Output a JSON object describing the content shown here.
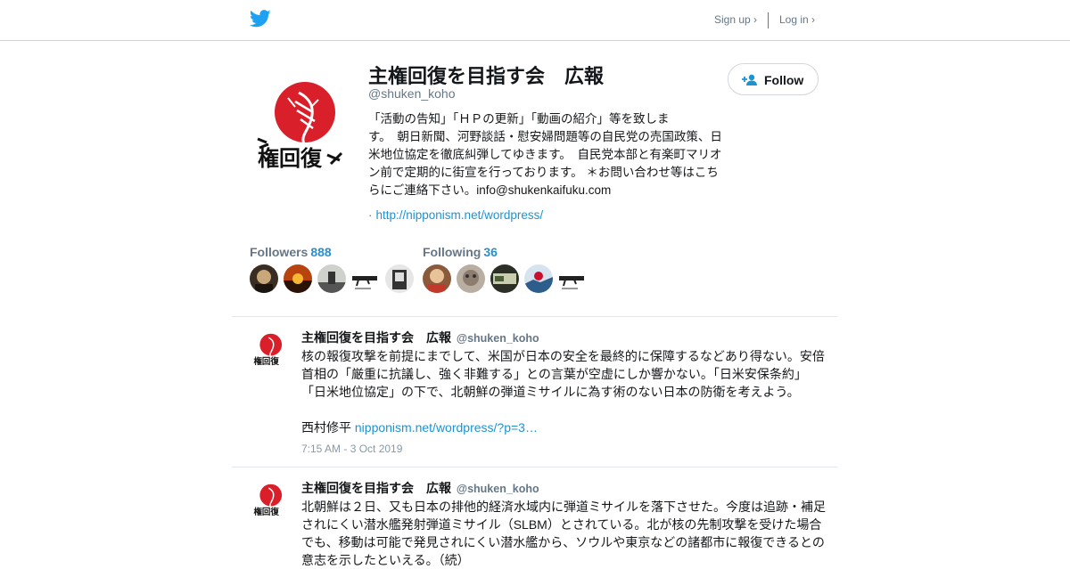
{
  "header": {
    "logo_icon": "twitter-bird-icon",
    "signup_label": "Sign up ›",
    "login_label": "Log in ›"
  },
  "profile": {
    "name": "主権回復を目指す会　広報",
    "handle": "@shuken_koho",
    "avatar_icon": "red-circle-logo-avatar",
    "bio_lines": [
      "「活動の告知」「ＨＰの更新」「動画の紹介」等を致しま",
      "す。　朝日新聞、河野談話・慰安婦問題等の自民党の売国政策、日",
      "米地位協定を徹底糾弾してゆきます。　自民党本部と有楽町マリオ",
      "ン前で定期的に街宣を行っております。 ＊お問い合わせ等はこち",
      "らにご連絡下さい。info@shukenkaifuku.com"
    ],
    "link_dot": "·",
    "link": "http://nipponism.net/wordpress/",
    "follow_label": "Follow",
    "follow_icon": "add-person-icon"
  },
  "stats": {
    "followers_label": "Followers",
    "followers_count": "888",
    "following_label": "Following",
    "following_count": "36"
  },
  "tweets": [
    {
      "name": "主権回復を目指す会　広報",
      "handle": "@shuken_koho",
      "lines": [
        "核の報復攻撃を前提にまでして、米国が日本の安全を最終的に保障するなどあり得ない。安倍",
        "首相の「厳重に抗議し、強く非難する」との言葉が空虚にしか響かない。「日米安保条約」",
        "「日米地位協定」の下で、北朝鮮の弾道ミサイルに為す術のない日本の防衛を考えよう。"
      ],
      "signature": "西村修平 ",
      "link": "nipponism.net/wordpress/?p=3…",
      "time": "7:15 AM - 3 Oct 2019"
    },
    {
      "name": "主権回復を目指す会　広報",
      "handle": "@shuken_koho",
      "lines": [
        "北朝鮮は２日、又も日本の排他的経済水域内に弾道ミサイルを落下させた。今度は追跡・補足",
        "されにくい潜水艦発射弾道ミサイル（SLBM）とされている。北が核の先制攻撃を受けた場合",
        "でも、移動は可能で発見されにくい潜水艦から、ソウルや東京などの諸都市に報復できるとの",
        "意志を示したといえる。（続）"
      ]
    }
  ],
  "colors": {
    "link": "#1d93d4",
    "twitter_blue": "#1da1f2",
    "muted": "#657786",
    "logo_red": "#d9202a"
  }
}
